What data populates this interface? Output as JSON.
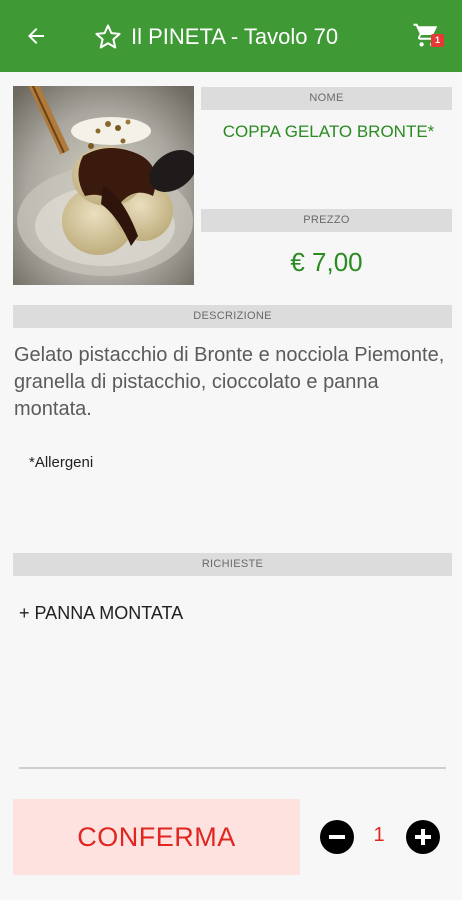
{
  "appbar": {
    "title": "Il PINETA - Tavolo 70",
    "cart_count": "1",
    "bg_color": "#3f9a35"
  },
  "product": {
    "name_label": "NOME",
    "name": "COPPA GELATO BRONTE*",
    "price_label": "PREZZO",
    "price": "€ 7,00",
    "description_label": "DESCRIZIONE",
    "description": "Gelato pistacchio di Bronte e nocciola Piemonte, granella di pistacchio, cioccolato e panna montata.",
    "allergens": "*Allergeni"
  },
  "requests": {
    "label": "RICHIESTE",
    "items": [
      "+ PANNA MONTATA"
    ]
  },
  "footer": {
    "confirm_label": "CONFERMA",
    "quantity": "1"
  },
  "icons": {
    "back": "arrow-left-icon",
    "favorite": "star-outline-icon",
    "cart": "cart-icon",
    "minus": "minus-circle-icon",
    "plus": "plus-circle-icon"
  }
}
